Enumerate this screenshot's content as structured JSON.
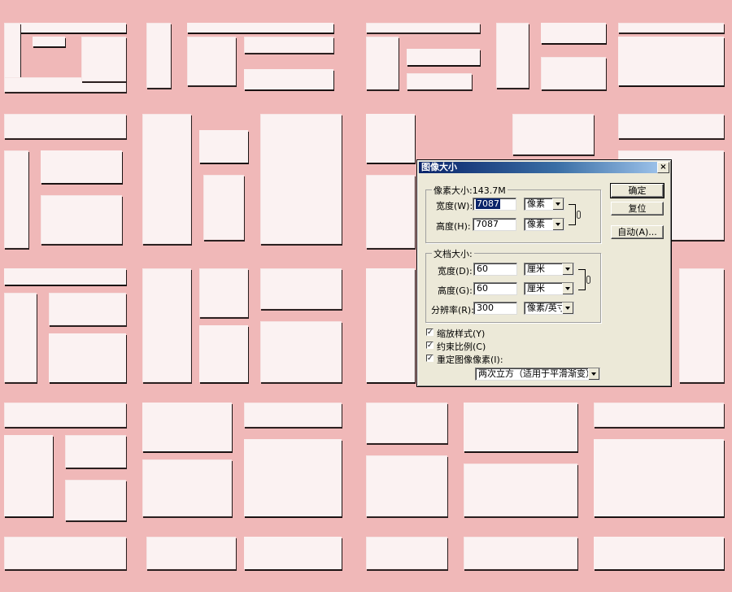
{
  "dialog": {
    "title": "图像大小",
    "close_glyph": "×",
    "pixel_group": {
      "legend": "像素大小:143.7M",
      "width_label": "宽度(W):",
      "width_value": "7087",
      "width_unit": "像素",
      "height_label": "高度(H):",
      "height_value": "7087",
      "height_unit": "像素"
    },
    "doc_group": {
      "legend": "文档大小:",
      "width_label": "宽度(D):",
      "width_value": "60",
      "width_unit": "厘米",
      "height_label": "高度(G):",
      "height_value": "60",
      "height_unit": "厘米",
      "res_label": "分辨率(R):",
      "res_value": "300",
      "res_unit": "像素/英寸"
    },
    "checkboxes": {
      "scale_styles": "缩放样式(Y)",
      "constrain": "约束比例(C)",
      "resample": "重定图像像素(I):",
      "check_glyph": "✓"
    },
    "resample_method": "两次立方（适用于平滑渐变）",
    "buttons": {
      "ok": "确定",
      "reset": "复位",
      "auto": "自动(A)..."
    }
  },
  "colors": {
    "canvas_pink": "#f0b8b8",
    "block_white": "#fbf2f2",
    "dialog_face": "#ece9d8",
    "title_blue": "#0a246a"
  }
}
